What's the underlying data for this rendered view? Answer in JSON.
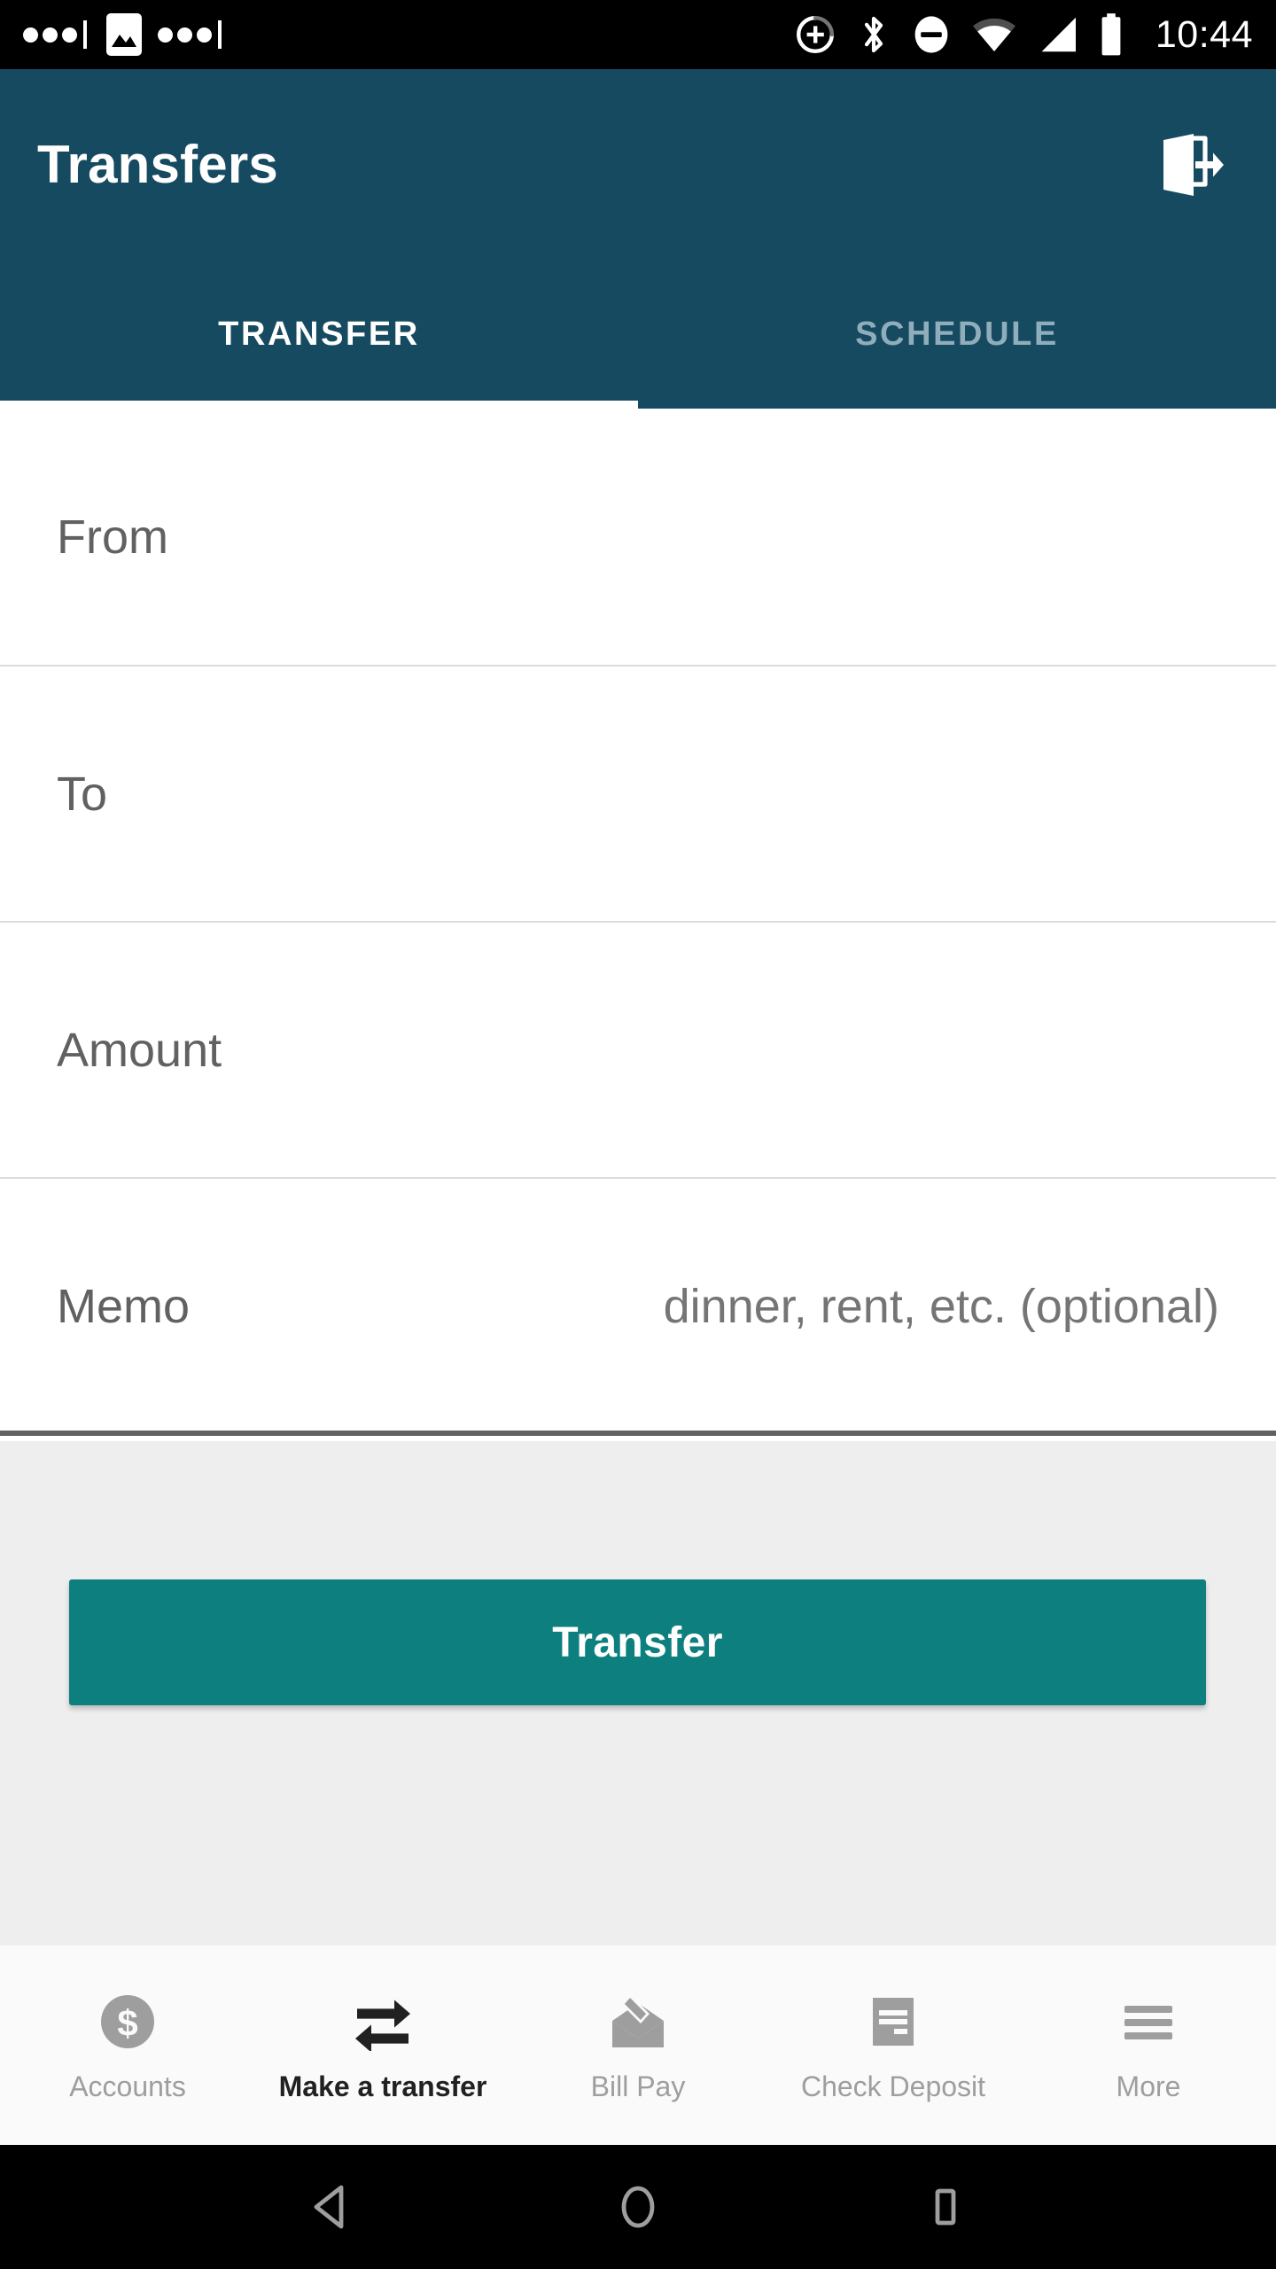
{
  "status_bar": {
    "time": "10:44",
    "icons": [
      "notification-dots-icon",
      "image-icon",
      "notification-dots-icon",
      "sync-circle-plus-icon",
      "bluetooth-icon",
      "do-not-disturb-icon",
      "wifi-icon",
      "cell-signal-icon",
      "battery-icon"
    ]
  },
  "app_bar": {
    "title": "Transfers",
    "logout_icon": "logout-icon",
    "background_color": "#164a60"
  },
  "tabs": [
    {
      "label": "TRANSFER",
      "active": true
    },
    {
      "label": "SCHEDULE",
      "active": false
    }
  ],
  "form": {
    "rows": [
      {
        "label": "From",
        "placeholder": ""
      },
      {
        "label": "To",
        "placeholder": ""
      },
      {
        "label": "Amount",
        "placeholder": ""
      },
      {
        "label": "Memo",
        "placeholder": "dinner, rent, etc. (optional)"
      }
    ]
  },
  "action": {
    "transfer_label": "Transfer",
    "button_color": "#0d7f7f"
  },
  "bottom_nav": [
    {
      "label": "Accounts",
      "icon": "dollar-circle-icon",
      "active": false
    },
    {
      "label": "Make a transfer",
      "icon": "swap-arrows-icon",
      "active": true
    },
    {
      "label": "Bill Pay",
      "icon": "envelope-pen-icon",
      "active": false
    },
    {
      "label": "Check Deposit",
      "icon": "check-card-icon",
      "active": false
    },
    {
      "label": "More",
      "icon": "hamburger-menu-icon",
      "active": false
    }
  ],
  "android_nav": [
    {
      "name": "back-button",
      "icon": "back-triangle-icon"
    },
    {
      "name": "home-button",
      "icon": "home-circle-icon"
    },
    {
      "name": "recents-button",
      "icon": "recents-square-icon"
    }
  ]
}
